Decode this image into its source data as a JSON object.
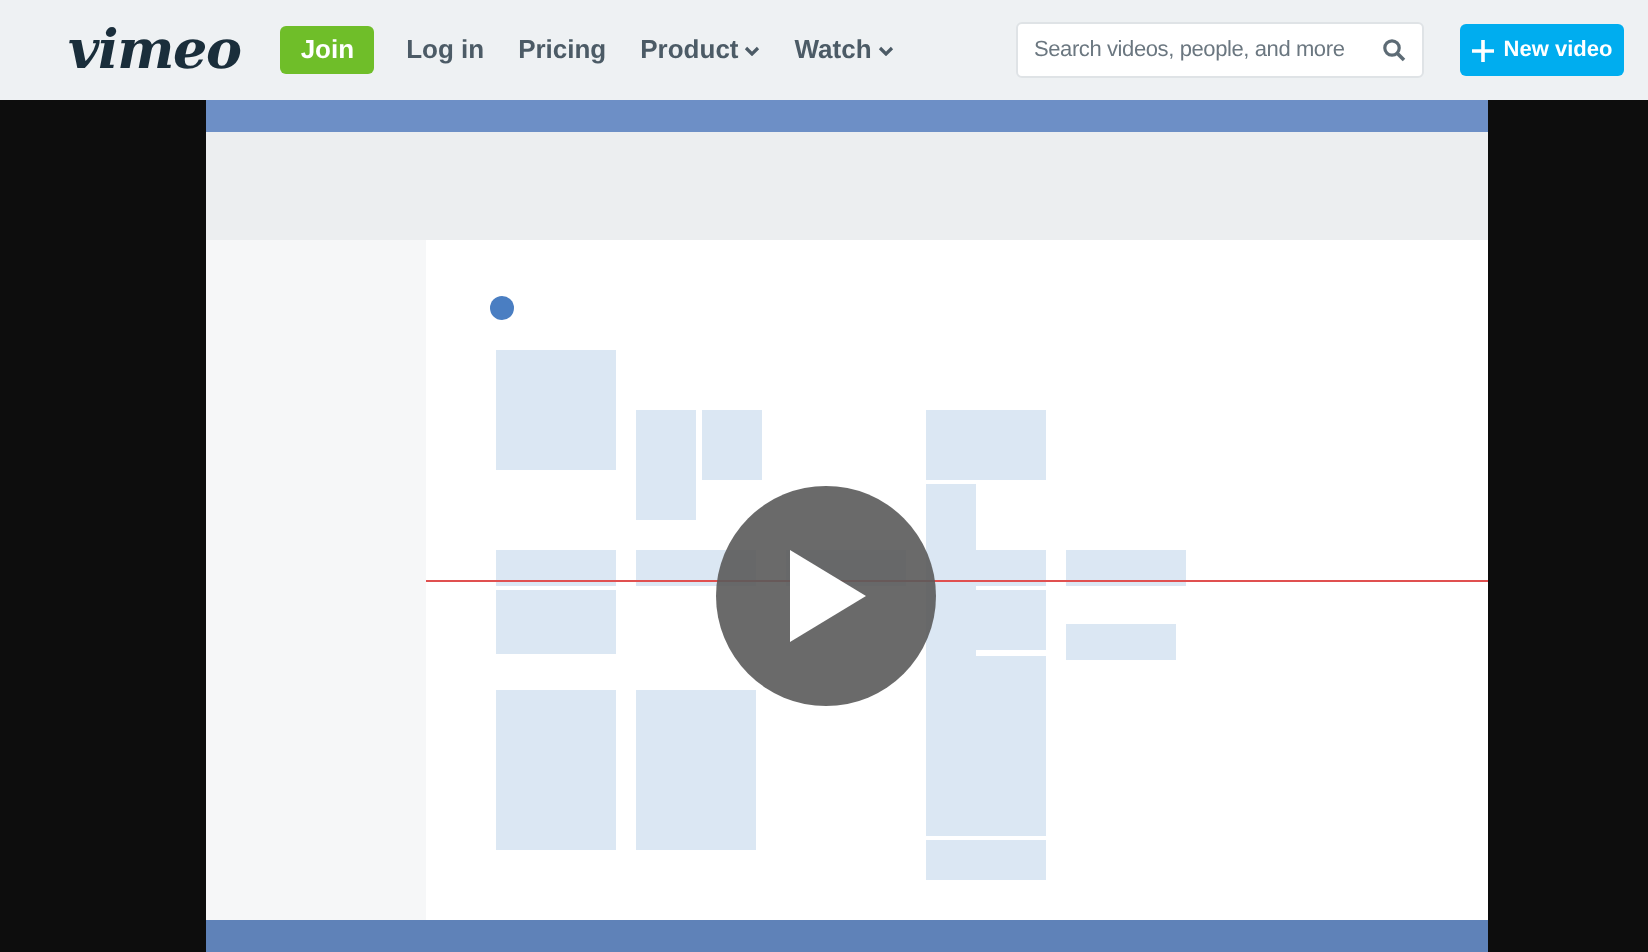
{
  "header": {
    "logo": "vimeo",
    "join": "Join",
    "nav": [
      {
        "label": "Log in",
        "dropdown": false
      },
      {
        "label": "Pricing",
        "dropdown": false
      },
      {
        "label": "Product",
        "dropdown": true
      },
      {
        "label": "Watch",
        "dropdown": true
      }
    ],
    "search": {
      "placeholder": "Search videos, people, and more"
    },
    "new_video": "New video"
  }
}
